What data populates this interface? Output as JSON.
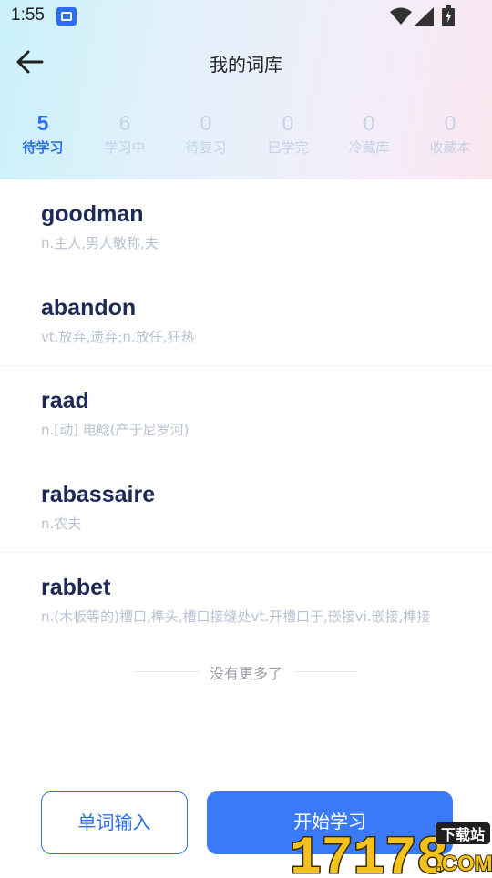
{
  "status_bar": {
    "time": "1:55",
    "icons": [
      "app-notification-icon",
      "wifi-icon",
      "signal-icon",
      "battery-icon"
    ]
  },
  "header": {
    "title": "我的词库",
    "back_icon": "arrow-left-icon"
  },
  "tabs": [
    {
      "count": "5",
      "label": "待学习",
      "active": true
    },
    {
      "count": "6",
      "label": "学习中",
      "active": false
    },
    {
      "count": "0",
      "label": "待复习",
      "active": false
    },
    {
      "count": "0",
      "label": "已学完",
      "active": false
    },
    {
      "count": "0",
      "label": "冷藏库",
      "active": false
    },
    {
      "count": "0",
      "label": "收藏本",
      "active": false
    }
  ],
  "words": [
    {
      "term": "goodman",
      "definition": "n.主人,男人敬称,夫"
    },
    {
      "term": "abandon",
      "definition": "vt.放弃,遗弃;n.放任,狂热"
    },
    {
      "term": "raad",
      "definition": "n.[动] 电鲶(产于尼罗河)"
    },
    {
      "term": "rabassaire",
      "definition": "n.农夫"
    },
    {
      "term": "rabbet",
      "definition": "n.(木板等的)槽口,榫头,槽口接缝处vt.开槽口于,嵌接vi.嵌接,榫接"
    }
  ],
  "end_text": "没有更多了",
  "buttons": {
    "input_label": "单词输入",
    "start_label": "开始学习"
  },
  "watermark": {
    "text": "17178",
    "badge": "下载站",
    "suffix": ".COM"
  },
  "colors": {
    "accent": "#2b6ff0",
    "start_button": "#3a7af8",
    "term": "#1e2a55",
    "definition": "#b9c2d2",
    "inactive_tab": "#c5d2e5"
  }
}
